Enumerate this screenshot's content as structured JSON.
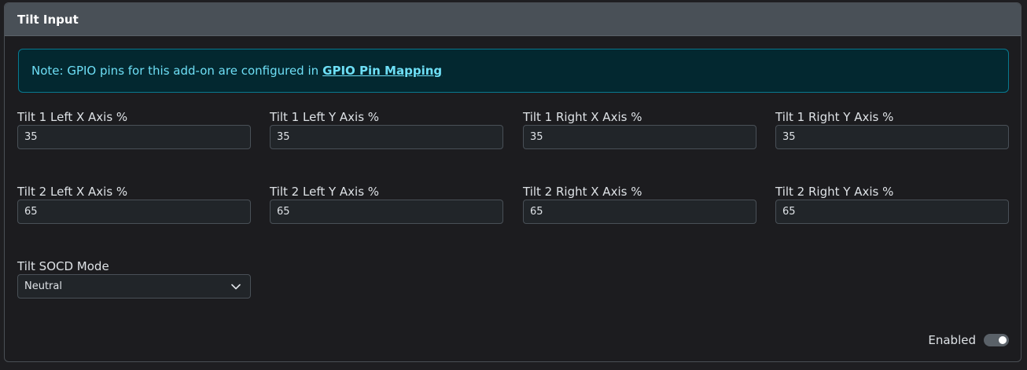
{
  "header": {
    "title": "Tilt Input"
  },
  "note": {
    "text": "Note: GPIO pins for this add-on are configured in",
    "link": "GPIO Pin Mapping"
  },
  "fields": {
    "tilt1_left_x": {
      "label": "Tilt 1 Left X Axis %",
      "value": "35"
    },
    "tilt1_left_y": {
      "label": "Tilt 1 Left Y Axis %",
      "value": "35"
    },
    "tilt1_right_x": {
      "label": "Tilt 1 Right X Axis %",
      "value": "35"
    },
    "tilt1_right_y": {
      "label": "Tilt 1 Right Y Axis %",
      "value": "35"
    },
    "tilt2_left_x": {
      "label": "Tilt 2 Left X Axis %",
      "value": "65"
    },
    "tilt2_left_y": {
      "label": "Tilt 2 Left Y Axis %",
      "value": "65"
    },
    "tilt2_right_x": {
      "label": "Tilt 2 Right X Axis %",
      "value": "65"
    },
    "tilt2_right_y": {
      "label": "Tilt 2 Right Y Axis %",
      "value": "65"
    }
  },
  "socd": {
    "label": "Tilt SOCD Mode",
    "selected": "Neutral",
    "icon": "chevron-down-icon"
  },
  "enabled": {
    "label": "Enabled",
    "on": true
  }
}
